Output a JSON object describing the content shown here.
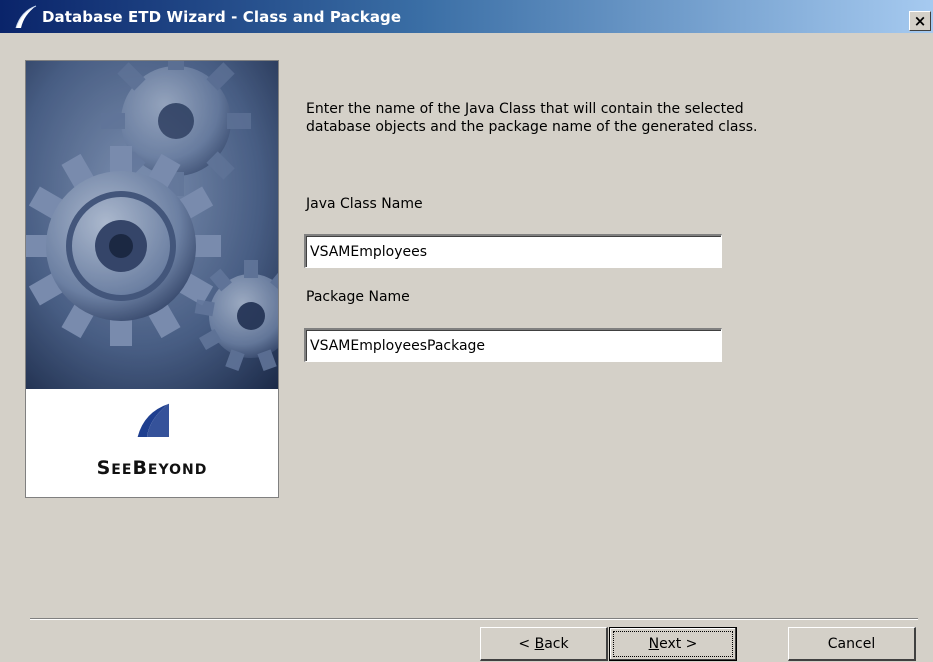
{
  "window": {
    "title": "Database ETD Wizard - Class and Package",
    "close_label": "×"
  },
  "banner": {
    "logo_text_first": "S",
    "logo_text_rest": "EE",
    "logo_text_b": "B",
    "logo_text_end": "EYOND"
  },
  "content": {
    "intro": "Enter the name of the Java Class that will contain the selected database objects and the package name of the generated class.",
    "java_class_label": "Java Class Name",
    "java_class_value": "VSAMEmployees",
    "package_label": "Package Name",
    "package_value": "VSAMEmployeesPackage"
  },
  "buttons": {
    "back_prefix": "< ",
    "back_mnemonic": "B",
    "back_rest": "ack",
    "next_mnemonic": "N",
    "next_rest": "ext >",
    "cancel": "Cancel"
  },
  "colors": {
    "titlebar_start": "#0a246a",
    "titlebar_end": "#a6caf0",
    "dialog_bg": "#d4d0c8",
    "logo_blue": "#1f3f8f"
  }
}
